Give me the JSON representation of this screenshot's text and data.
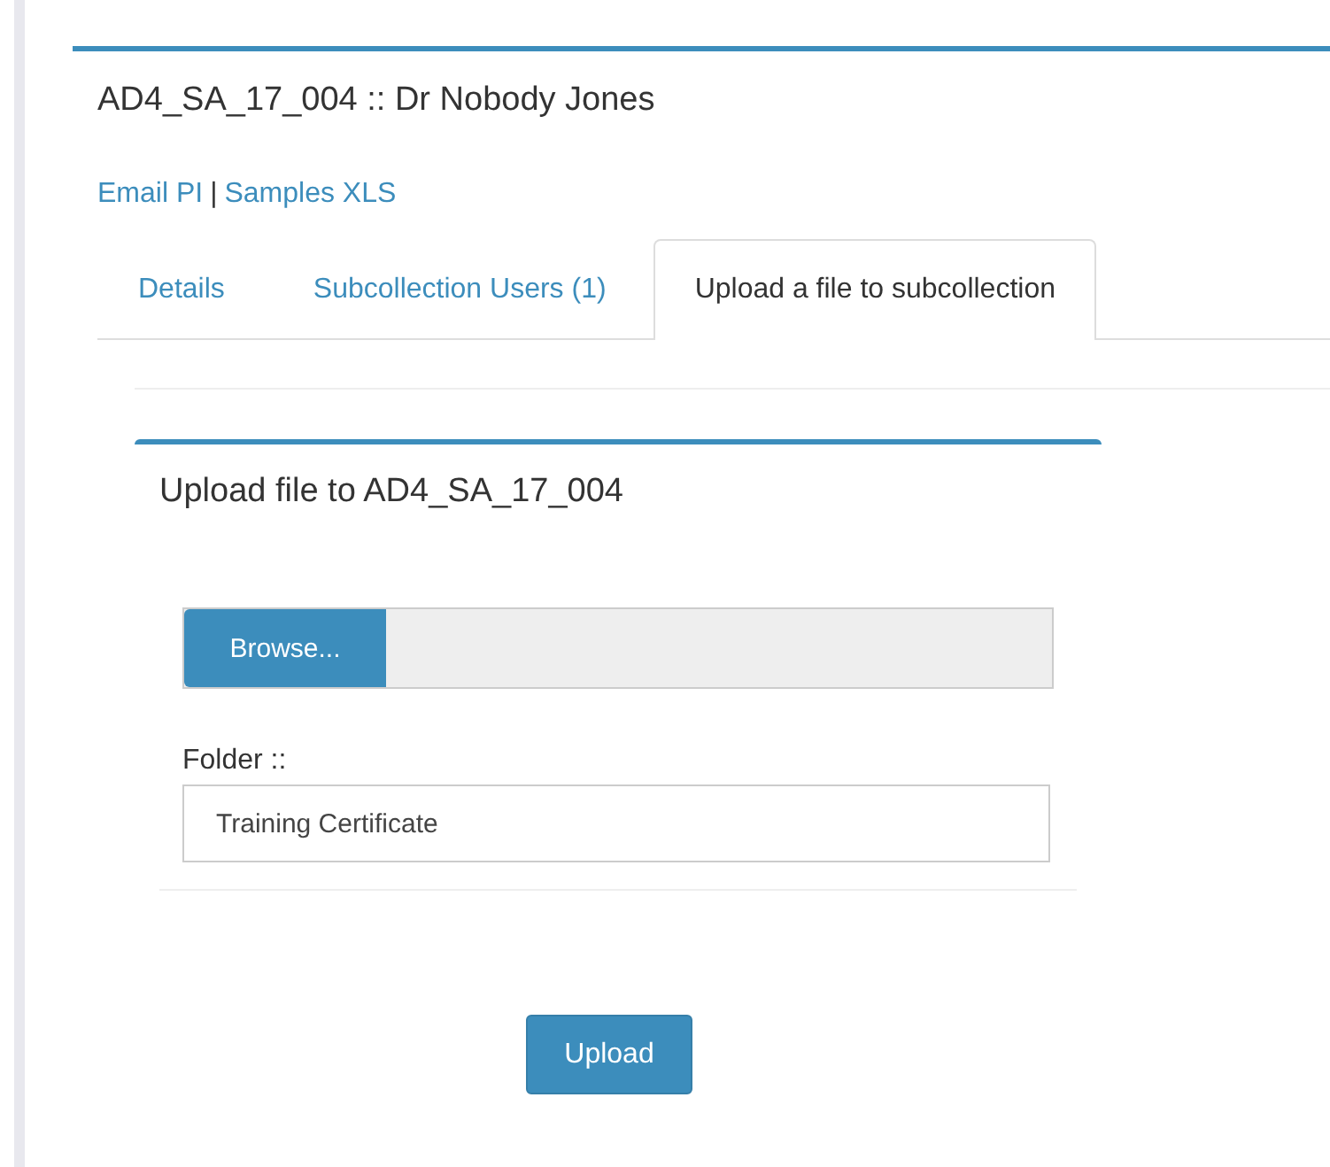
{
  "header": {
    "title": "AD4_SA_17_004 :: Dr Nobody Jones"
  },
  "links": [
    {
      "label": "Email PI"
    },
    {
      "label": "Samples XLS"
    }
  ],
  "link_separator": "|",
  "tabs": [
    {
      "label": "Details",
      "selected": false
    },
    {
      "label": "Subcollection Users (1)",
      "selected": false
    },
    {
      "label": "Upload a file to subcollection",
      "selected": true
    }
  ],
  "upload_box": {
    "title": "Upload file to AD4_SA_17_004",
    "browse_button": "Browse...",
    "folder_label": "Folder ::",
    "folder_value": "Training Certificate",
    "upload_button": "Upload"
  }
}
